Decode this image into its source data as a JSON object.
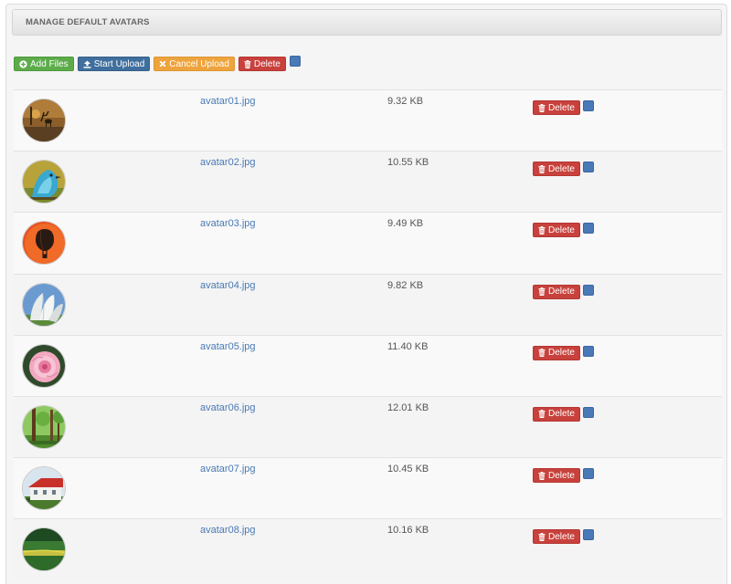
{
  "panel": {
    "title": "MANAGE DEFAULT AVATARS"
  },
  "toolbar": {
    "add_files": "Add Files",
    "start_upload": "Start Upload",
    "cancel_upload": "Cancel Upload",
    "delete": "Delete"
  },
  "files": [
    {
      "name": "avatar01.jpg",
      "size": "9.32 KB",
      "delete": "Delete",
      "thumb": "deer-at-sunset"
    },
    {
      "name": "avatar02.jpg",
      "size": "10.55 KB",
      "delete": "Delete",
      "thumb": "blue-bird"
    },
    {
      "name": "avatar03.jpg",
      "size": "9.49 KB",
      "delete": "Delete",
      "thumb": "hot-air-balloon"
    },
    {
      "name": "avatar04.jpg",
      "size": "9.82 KB",
      "delete": "Delete",
      "thumb": "white-tulips"
    },
    {
      "name": "avatar05.jpg",
      "size": "11.40 KB",
      "delete": "Delete",
      "thumb": "pink-peony"
    },
    {
      "name": "avatar06.jpg",
      "size": "12.01 KB",
      "delete": "Delete",
      "thumb": "forest"
    },
    {
      "name": "avatar07.jpg",
      "size": "10.45 KB",
      "delete": "Delete",
      "thumb": "farmhouse"
    },
    {
      "name": "avatar08.jpg",
      "size": "10.16 KB",
      "delete": "Delete",
      "thumb": "field-landscape"
    }
  ],
  "colors": {
    "success": "#5cac4a",
    "primary": "#3f6f9e",
    "warning": "#eea43d",
    "danger": "#c8413c",
    "link": "#4a7ab5",
    "checkbox": "#4a79b8"
  }
}
